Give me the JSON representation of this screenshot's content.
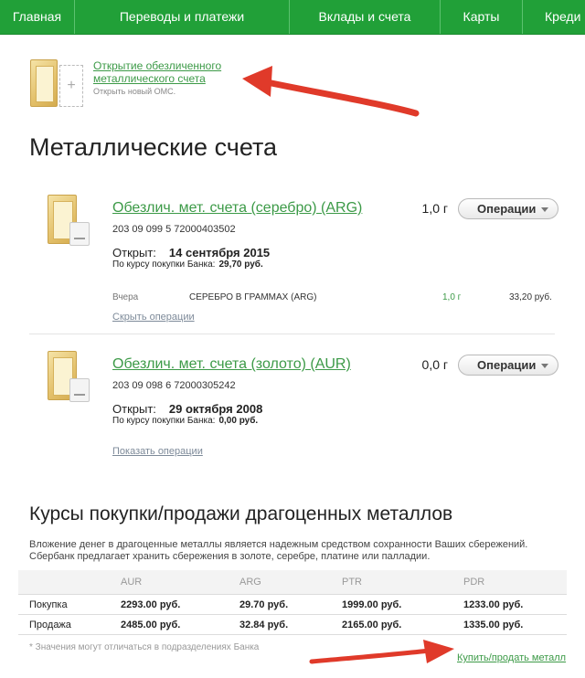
{
  "nav": {
    "items": [
      "Главная",
      "Переводы и платежи",
      "Вклады и счета",
      "Карты",
      "Креди"
    ]
  },
  "open_account": {
    "link": "Открытие обезличенного металлического счета",
    "link_line1": "Открытие обезличенного",
    "link_line2": "металлического счета",
    "subtitle": "Открыть новый ОМС."
  },
  "page_title": "Металлические счета",
  "accounts": [
    {
      "title": "Обезлич. мет. счета (серебро) (ARG)",
      "number": "203 09 099 5 72000403502",
      "amount": "1,0 г",
      "operations_button": "Операции",
      "opened_label": "Открыт:",
      "opened_date": "14 сентября 2015",
      "rate_label": "По курсу покупки Банка:",
      "rate_value": "29,70 руб.",
      "operation": {
        "date": "Вчера",
        "description": "СЕРЕБРО В ГРАММАХ (ARG)",
        "quantity": "1,0 г",
        "sum": "33,20 руб."
      },
      "toggle_link": "Скрыть операции"
    },
    {
      "title": "Обезлич. мет. счета (золото) (AUR)",
      "number": "203 09 098 6 72000305242",
      "amount": "0,0 г",
      "operations_button": "Операции",
      "opened_label": "Открыт:",
      "opened_date": "29 октября 2008",
      "rate_label": "По курсу покупки Банка:",
      "rate_value": "0,00 руб.",
      "toggle_link": "Показать операции"
    }
  ],
  "rates_section": {
    "title": "Курсы покупки/продажи драгоценных металлов",
    "intro": "Вложение денег в драгоценные металлы является надежным средством сохранности Ваших сбережений. Сбербанк предлагает хранить сбережения в золоте, серебре, платине или палладии.",
    "columns": [
      "AUR",
      "ARG",
      "PTR",
      "PDR"
    ],
    "rows": [
      {
        "label": "Покупка",
        "values": [
          "2293.00 руб.",
          "29.70 руб.",
          "1999.00 руб.",
          "1233.00 руб."
        ]
      },
      {
        "label": "Продажа",
        "values": [
          "2485.00 руб.",
          "32.84 руб.",
          "2165.00 руб.",
          "1335.00 руб."
        ]
      }
    ],
    "footnote": "* Значения могут отличаться в подразделениях Банка",
    "buy_sell_link": "Купить/продать металл"
  },
  "colors": {
    "brand_green": "#21a038",
    "link_green": "#3c9a47",
    "arrow_red": "#e03a2a"
  }
}
